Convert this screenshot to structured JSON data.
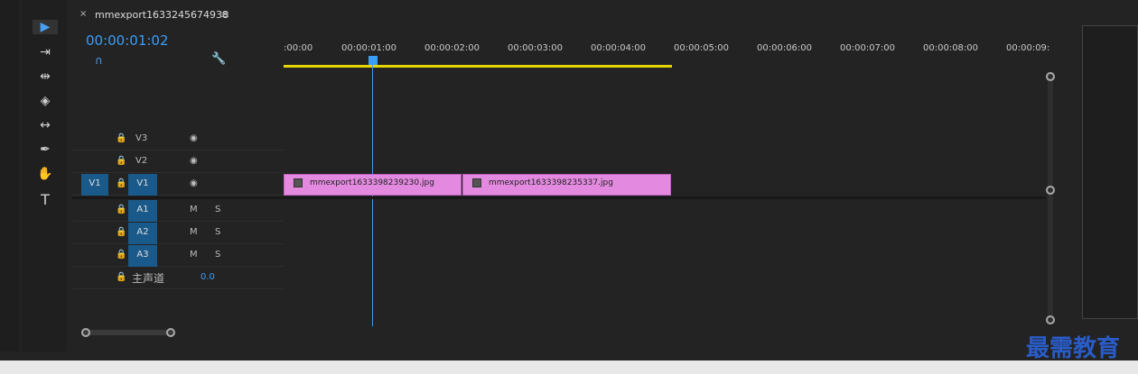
{
  "sequence": {
    "name": "mmexport1633245674938",
    "timecode": "00:00:01:02"
  },
  "ruler": [
    ":00:00",
    "00:00:01:00",
    "00:00:02:00",
    "00:00:03:00",
    "00:00:04:00",
    "00:00:05:00",
    "00:00:06:00",
    "00:00:07:00",
    "00:00:08:00",
    "00:00:09:"
  ],
  "tracks": {
    "v3": "V3",
    "v2": "V2",
    "v1": "V1",
    "v1src": "V1",
    "a1": "A1",
    "a2": "A2",
    "a3": "A3",
    "m": "M",
    "s": "S"
  },
  "master": {
    "label": "主声道",
    "value": "0.0"
  },
  "clips": [
    "mmexport1633398239230.jpg",
    "mmexport1633398235337.jpg"
  ],
  "watermark": "最需教育"
}
